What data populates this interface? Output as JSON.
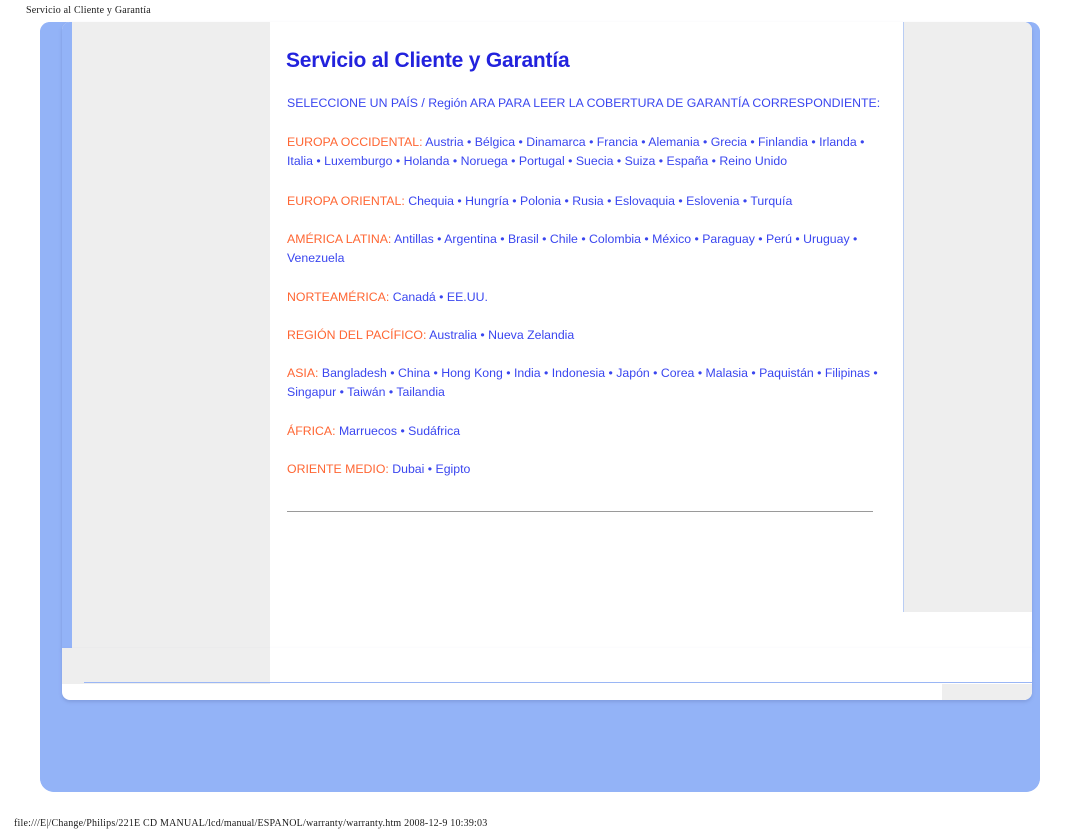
{
  "print_header": "Servicio al Cliente y Garantía",
  "print_footer": "file:///E|/Change/Philips/221E CD MANUAL/lcd/manual/ESPANOL/warranty/warranty.htm 2008-12-9 10:39:03",
  "colors": {
    "page_blue": "#93b3f7",
    "title_blue": "#2222dd",
    "link_blue": "#3a46ef",
    "region_orange": "#ff6633",
    "nav_gray": "#eeeeee",
    "rule_gray": "#9a9a9a"
  },
  "document": {
    "title": "Servicio al Cliente y Garantía",
    "intro": "SELECCIONE UN PAÍS / Región ARA PARA LEER LA COBERTURA DE GARANTÍA CORRESPONDIENTE:",
    "separator": " • ",
    "regions": [
      {
        "label": "EUROPA OCCIDENTAL:",
        "countries": [
          "Austria",
          "Bélgica",
          "Dinamarca",
          "Francia",
          "Alemania",
          "Grecia",
          "Finlandia",
          "Irlanda",
          "Italia",
          "Luxemburgo",
          "Holanda",
          "Noruega",
          "Portugal",
          "Suecia",
          "Suiza",
          "España",
          "Reino Unido"
        ]
      },
      {
        "label": "EUROPA ORIENTAL:",
        "countries": [
          "Chequia",
          "Hungría",
          "Polonia",
          "Rusia",
          "Eslovaquia",
          "Eslovenia",
          "Turquía"
        ]
      },
      {
        "label": "AMÉRICA LATINA:",
        "countries": [
          "Antillas",
          "Argentina",
          "Brasil",
          "Chile",
          "Colombia",
          "México",
          "Paraguay",
          "Perú",
          "Uruguay",
          "Venezuela"
        ]
      },
      {
        "label": "NORTEAMÉRICA:",
        "countries": [
          "Canadá",
          "EE.UU."
        ]
      },
      {
        "label": "REGIÓN DEL PACÍFICO:",
        "countries": [
          "Australia",
          "Nueva Zelandia"
        ]
      },
      {
        "label": "ASIA:",
        "countries": [
          "Bangladesh",
          "China",
          "Hong Kong",
          "India",
          "Indonesia",
          "Japón",
          "Corea",
          "Malasia",
          "Paquistán",
          "Filipinas",
          "Singapur",
          "Taiwán",
          "Tailandia"
        ]
      },
      {
        "label": "ÁFRICA:",
        "countries": [
          "Marruecos",
          "Sudáfrica"
        ]
      },
      {
        "label": "ORIENTE MEDIO:",
        "countries": [
          "Dubai",
          "Egipto"
        ]
      }
    ]
  }
}
